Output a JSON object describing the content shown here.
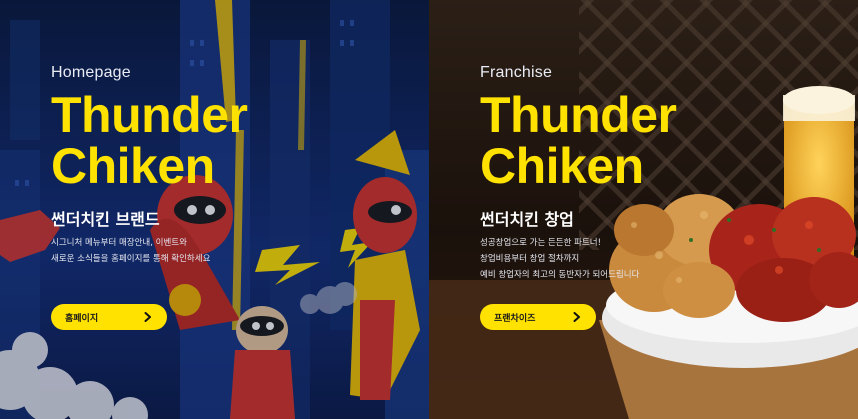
{
  "panels": [
    {
      "id": "homepage",
      "kicker": "Homepage",
      "title_line1": "Thunder",
      "title_line2": "Chiken",
      "subtitle": "썬더치킨 브랜드",
      "desc_lines": [
        "시그니처 메뉴부터 매장안내, 이벤트와",
        "새로운 소식들을 홈페이지를 통해 확인하세요"
      ],
      "button_label": "홈페이지",
      "button_icon": "chevron-right-icon",
      "background": "comic-hero-illustration"
    },
    {
      "id": "franchise",
      "kicker": "Franchise",
      "title_line1": "Thunder",
      "title_line2": "Chiken",
      "subtitle": "썬더치킨 창업",
      "desc_lines": [
        "성공창업으로 가는 든든한 파트너!",
        "창업비용부터 창업 절차까지",
        "예비 창업자의 최고의 동반자가 되어드립니다"
      ],
      "button_label": "프랜차이즈",
      "button_icon": "chevron-right-icon",
      "background": "fried-chicken-and-beer-photo"
    }
  ],
  "colors": {
    "accent": "#ffe200",
    "left_bg": "#0d1d4a",
    "right_bg": "#2a1c12",
    "text": "#ffffff"
  }
}
